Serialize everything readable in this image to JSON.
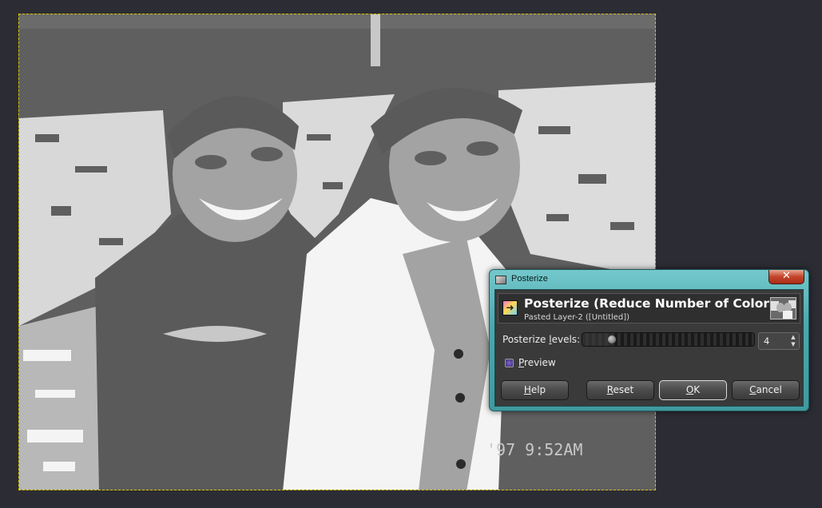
{
  "dialog": {
    "window_title": "Posterize",
    "close_label": "✕",
    "header_title": "Posterize (Reduce Number of Colors)",
    "header_subtitle": "Pasted Layer-2 ([Untitled])",
    "levels_label_pre": "Posterize ",
    "levels_label_u": "l",
    "levels_label_post": "evels:",
    "levels_value": "4",
    "levels_fraction": 0.17,
    "preview_label_u": "P",
    "preview_label_post": "review",
    "preview_checked": true,
    "buttons": {
      "help_u": "H",
      "help_post": "elp",
      "reset_u": "R",
      "reset_post": "eset",
      "ok_u": "O",
      "ok_post": "K",
      "cancel_u": "C",
      "cancel_post": "ancel"
    }
  },
  "canvas": {
    "watermark_text": "'97 9:52AM",
    "colors": {
      "background": "#2c2c34",
      "dark_gray": "#5f5f5f",
      "mid_gray": "#a3a3a3",
      "white": "#f4f4f4",
      "selection": "#d6c300"
    }
  }
}
